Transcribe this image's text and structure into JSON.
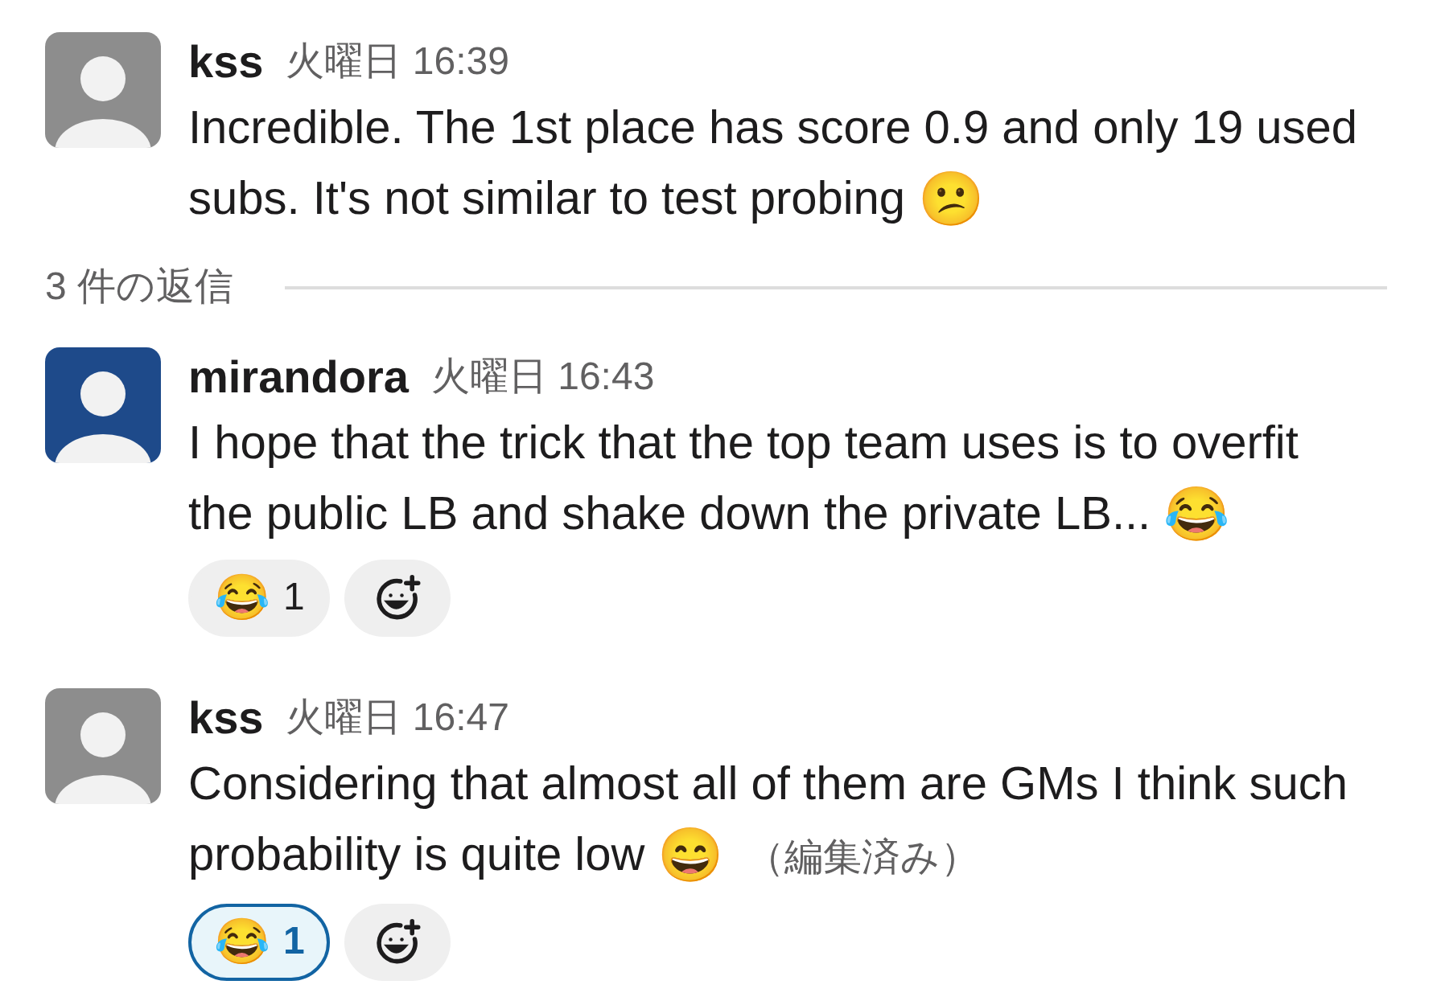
{
  "thread": {
    "parent": {
      "author": "kss",
      "color": "#8d8d8d",
      "time": "火曜日 16:39",
      "text": "Incredible. The 1st place has score 0.9 and only 19 used subs. It's not similar to test probing",
      "emoji": "😕"
    },
    "replies_label": "3 件の返信",
    "replies": [
      {
        "author": "mirandora",
        "color": "#1e4a8a",
        "time": "火曜日 16:43",
        "text": "I hope that the trick that the top team uses is to overfit the public LB and shake down the private LB...",
        "emoji": "😂",
        "reactions": [
          {
            "emoji": "😂",
            "count": "1",
            "selected": false
          }
        ]
      },
      {
        "author": "kss",
        "color": "#8d8d8d",
        "time": "火曜日 16:47",
        "text": "Considering that almost all of them are GMs I think such probability is quite low",
        "emoji": "😄",
        "edited_label": "（編集済み）",
        "reactions": [
          {
            "emoji": "😂",
            "count": "1",
            "selected": true
          }
        ]
      }
    ]
  }
}
